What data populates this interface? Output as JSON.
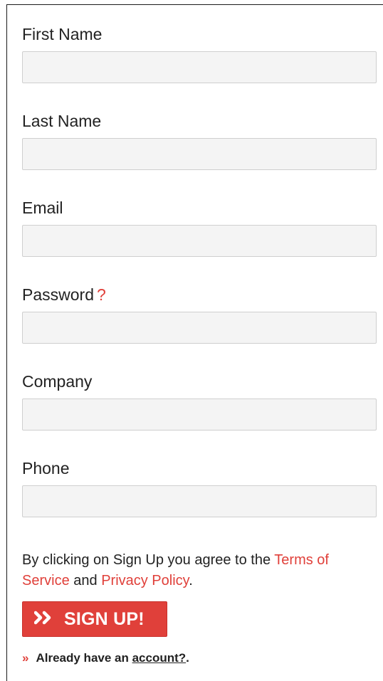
{
  "form": {
    "fields": [
      {
        "label": "First Name",
        "value": "",
        "placeholder": ""
      },
      {
        "label": "Last Name",
        "value": "",
        "placeholder": ""
      },
      {
        "label": "Email",
        "value": "",
        "placeholder": ""
      },
      {
        "label": "Password",
        "help": "?",
        "value": "",
        "placeholder": ""
      },
      {
        "label": "Company",
        "value": "",
        "placeholder": ""
      },
      {
        "label": "Phone",
        "value": "",
        "placeholder": ""
      }
    ],
    "terms": {
      "prefix": "By clicking on Sign Up you agree to the ",
      "terms_link": "Terms of Service",
      "middle": " and ",
      "privacy_link": "Privacy Policy",
      "suffix": "."
    },
    "signup_button": {
      "icon": "double-chevron-right-icon",
      "label": "SIGN UP!"
    },
    "login_prompt": {
      "bullet": "»",
      "prefix": "Already have an ",
      "link": "account?",
      "suffix": "."
    }
  },
  "colors": {
    "accent": "#e0403a",
    "input_bg": "#f4f4f4",
    "input_border": "#cfcfcf",
    "text": "#222222"
  }
}
